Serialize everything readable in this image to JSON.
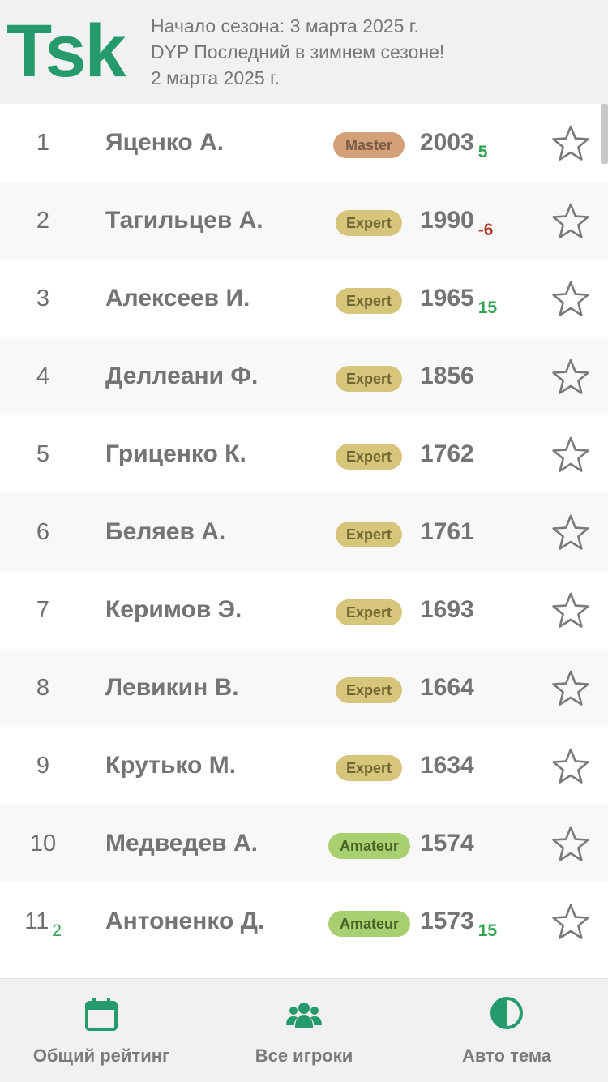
{
  "header": {
    "logo": "Tsk",
    "season_start": "Начало сезона: 3 марта 2025 г.",
    "tournament": "DYP Последний в зимнем сезоне!",
    "date": "2 марта 2025 г."
  },
  "colors": {
    "brand": "#259a6c",
    "positive_delta": "#2ea44f",
    "negative_delta": "#b03a2e",
    "master_badge": "#d4a07a",
    "expert_badge": "#d6c57a",
    "amateur_badge": "#a9d070"
  },
  "players": [
    {
      "rank": "1",
      "rank_delta": "",
      "name": "Яценко А.",
      "level": "Master",
      "rating": "2003",
      "delta": "5",
      "delta_sign": "pos"
    },
    {
      "rank": "2",
      "rank_delta": "",
      "name": "Тагильцев А.",
      "level": "Expert",
      "rating": "1990",
      "delta": "-6",
      "delta_sign": "neg"
    },
    {
      "rank": "3",
      "rank_delta": "",
      "name": "Алексеев И.",
      "level": "Expert",
      "rating": "1965",
      "delta": "15",
      "delta_sign": "pos"
    },
    {
      "rank": "4",
      "rank_delta": "",
      "name": "Деллеани Ф.",
      "level": "Expert",
      "rating": "1856",
      "delta": "",
      "delta_sign": ""
    },
    {
      "rank": "5",
      "rank_delta": "",
      "name": "Гриценко К.",
      "level": "Expert",
      "rating": "1762",
      "delta": "",
      "delta_sign": ""
    },
    {
      "rank": "6",
      "rank_delta": "",
      "name": "Беляев А.",
      "level": "Expert",
      "rating": "1761",
      "delta": "",
      "delta_sign": ""
    },
    {
      "rank": "7",
      "rank_delta": "",
      "name": "Керимов Э.",
      "level": "Expert",
      "rating": "1693",
      "delta": "",
      "delta_sign": ""
    },
    {
      "rank": "8",
      "rank_delta": "",
      "name": "Левикин В.",
      "level": "Expert",
      "rating": "1664",
      "delta": "",
      "delta_sign": ""
    },
    {
      "rank": "9",
      "rank_delta": "",
      "name": "Крутько М.",
      "level": "Expert",
      "rating": "1634",
      "delta": "",
      "delta_sign": ""
    },
    {
      "rank": "10",
      "rank_delta": "",
      "name": "Медведев А.",
      "level": "Amateur",
      "rating": "1574",
      "delta": "",
      "delta_sign": ""
    },
    {
      "rank": "11",
      "rank_delta": "2",
      "name": "Антоненко Д.",
      "level": "Amateur",
      "rating": "1573",
      "delta": "15",
      "delta_sign": "pos"
    }
  ],
  "favorite_icon": "star-outline-icon",
  "bottom_nav": [
    {
      "label": "Общий рейтинг",
      "icon": "calendar-icon"
    },
    {
      "label": "Все игроки",
      "icon": "group-icon"
    },
    {
      "label": "Авто тема",
      "icon": "contrast-icon"
    }
  ]
}
